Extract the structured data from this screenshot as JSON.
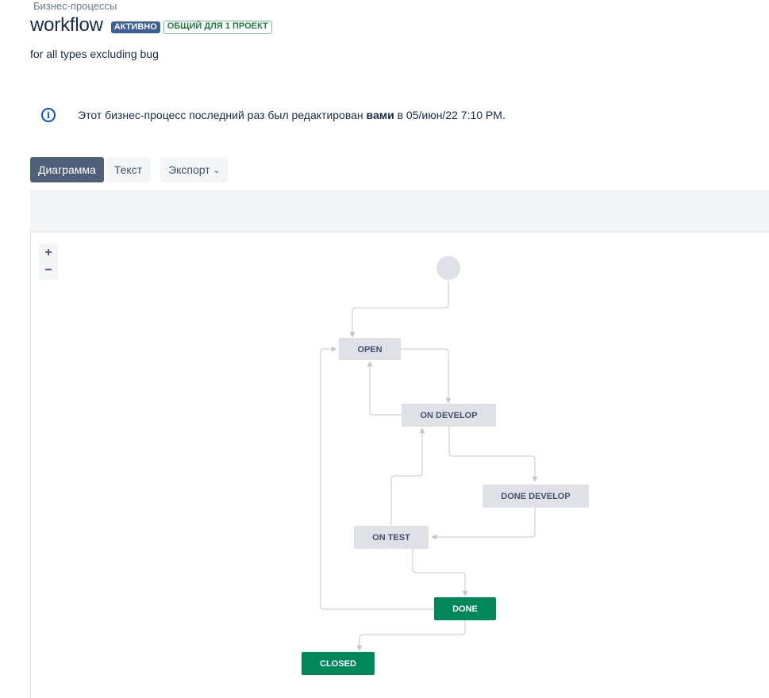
{
  "breadcrumb": "Бизнес-процессы",
  "header": {
    "title": "workflow",
    "status_badge": "АКТИВНО",
    "shared_badge": "ОБЩИЙ ДЛЯ 1 ПРОЕКТ"
  },
  "description": "for all types excluding bug",
  "info": {
    "icon": "info-icon",
    "text_before": "Этот бизнес-процесс последний раз был редактирован ",
    "user": "вами",
    "text_after": " в 05/июн/22 7:10 PM."
  },
  "tabs": {
    "diagram": "Диаграмма",
    "text": "Текст",
    "export": "Экспорт"
  },
  "zoom": {
    "in": "+",
    "out": "−"
  },
  "statuses": [
    {
      "id": "open",
      "label": "OPEN",
      "category": "todo"
    },
    {
      "id": "on_develop",
      "label": "ON DEVELOP",
      "category": "todo"
    },
    {
      "id": "done_develop",
      "label": "DONE DEVELOP",
      "category": "todo"
    },
    {
      "id": "on_test",
      "label": "ON TEST",
      "category": "todo"
    },
    {
      "id": "done",
      "label": "DONE",
      "category": "done"
    },
    {
      "id": "closed",
      "label": "CLOSED",
      "category": "done"
    }
  ],
  "colors": {
    "todo_fill": "#dfe1e6",
    "todo_text": "#42526e",
    "done_fill": "#00875a",
    "done_text": "#ffffff",
    "connector": "#c1c7d0",
    "accent": "#505f79"
  }
}
